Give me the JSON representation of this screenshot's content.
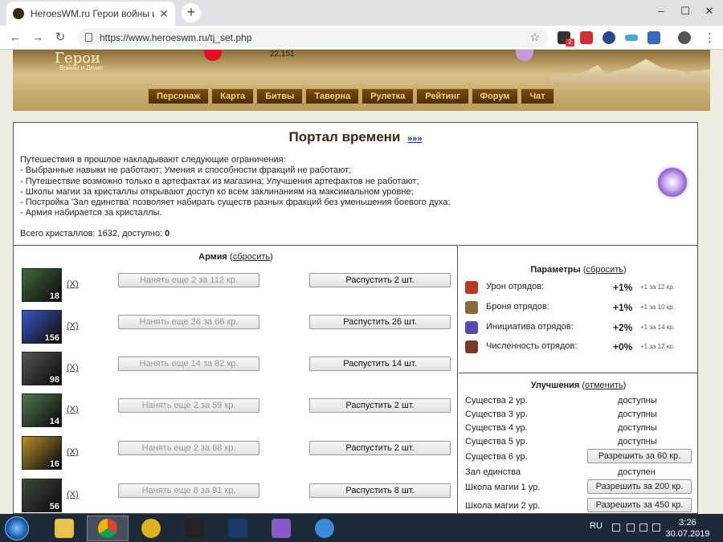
{
  "browser": {
    "tab_title": "HeroesWM.ru Герои войны и де",
    "new_tab": "+",
    "url": "https://www.heroeswm.ru/tj_set.php",
    "extension_badge": "2"
  },
  "game_header": {
    "logo_text": "Герои",
    "logo_sub": "Войны и Денег",
    "resources": "22,151",
    "nav": [
      "Персонаж",
      "Карта",
      "Битвы",
      "Таверна",
      "Рулетка",
      "Рейтинг",
      "Форум",
      "Чат"
    ]
  },
  "portal": {
    "title": "Портал времени",
    "title_link": "»»»",
    "restrictions": [
      "Путешествия в прошлое накладывают следующие ограничения:",
      "- Выбранные навыки не работают; Умения и способности фракций не работают;",
      "- Путешествие возможно только в артефактах из магазина; Улучшения артефактов не работают;",
      "- Школы магии за кристаллы открывают доступ ко всем заклинаниям на максимальном уровне;",
      "- Постройка 'Зал единства' позволяет набирать существ разных фракций без уменьшения боевого духа;",
      "- Армия набирается за кристаллы."
    ],
    "crystals_label": "Всего кристаллов: 1632, доступно:",
    "crystals_available": "0"
  },
  "army": {
    "title": "Армия",
    "reset": "сбросить",
    "units": [
      {
        "count": "18",
        "x": "(X)",
        "hire": "Нанять еще 2 за 112 кр.",
        "dismiss": "Распустить 2 шт.",
        "color": "#3d6b3a"
      },
      {
        "count": "156",
        "x": "(X)",
        "hire": "Нанять еще 26 за 66 кр.",
        "dismiss": "Распустить 26 шт.",
        "color": "#3b55c8"
      },
      {
        "count": "98",
        "x": "(X)",
        "hire": "Нанять еще 14 за 82 кр.",
        "dismiss": "Распустить 14 шт.",
        "color": "#5a5350"
      },
      {
        "count": "14",
        "x": "(X)",
        "hire": "Нанять еще 2 за 59 кр.",
        "dismiss": "Распустить 2 шт.",
        "color": "#4f7a52"
      },
      {
        "count": "16",
        "x": "(X)",
        "hire": "Нанять еще 2 за 68 кр.",
        "dismiss": "Распустить 2 шт.",
        "color": "#b8902a"
      },
      {
        "count": "56",
        "x": "(X)",
        "hire": "Нанять еще 8 за 91 кр.",
        "dismiss": "Распустить 8 шт.",
        "color": "#3e4a3a"
      }
    ]
  },
  "params": {
    "title": "Параметры",
    "reset": "сбросить",
    "items": [
      {
        "label": "Урон отрядов:",
        "value": "+1%",
        "cost": "+1 за 12 кр.",
        "color": "#b63a2a",
        "icon": "sword-icon"
      },
      {
        "label": "Броня отрядов:",
        "value": "+1%",
        "cost": "+1 за 10 кр.",
        "color": "#8a6a3a",
        "icon": "shield-icon"
      },
      {
        "label": "Инициатива отрядов:",
        "value": "+2%",
        "cost": "+1 за 14 кр.",
        "color": "#5a4ab0",
        "icon": "initiative-icon"
      },
      {
        "label": "Численность отрядов:",
        "value": "+0%",
        "cost": "+1 за 12 кр.",
        "color": "#7a3a2a",
        "icon": "troops-icon"
      }
    ]
  },
  "upgrades": {
    "title": "Улучшения",
    "cancel": "отменить",
    "items": [
      {
        "label": "Существа 2 ур.",
        "status": "доступны"
      },
      {
        "label": "Существа 3 ур.",
        "status": "доступны"
      },
      {
        "label": "Существа 4 ур.",
        "status": "доступны"
      },
      {
        "label": "Существа 5 ур.",
        "status": "доступны"
      },
      {
        "label": "Существа 6 ур.",
        "button": "Разрешить за 60 кр."
      },
      {
        "label": "Зал единства",
        "status": "доступен"
      },
      {
        "label": "Школа магии 1 ур.",
        "button": "Разрешить за 200 кр."
      },
      {
        "label": "Школа магии 2 ур.",
        "button": "Разрешить за 450 кр."
      }
    ]
  },
  "taskbar": {
    "lang": "RU",
    "time": "3:26",
    "date": "30.07.2019"
  }
}
